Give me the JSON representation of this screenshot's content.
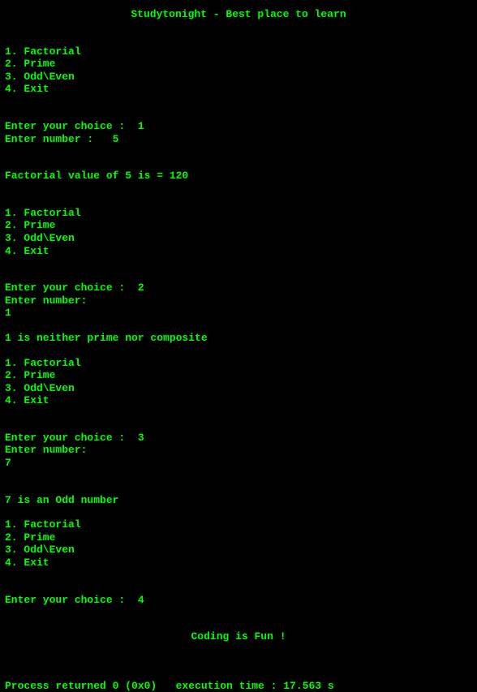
{
  "header": "Studytonight - Best place to learn",
  "menu": {
    "item1": "1. Factorial",
    "item2": "2. Prime",
    "item3": "3. Odd\\Even",
    "item4": "4. Exit"
  },
  "run1": {
    "prompt_choice": "Enter your choice :  1",
    "prompt_number": "Enter number :   5",
    "result": "Factorial value of 5 is = 120"
  },
  "run2": {
    "prompt_choice": "Enter your choice :  2",
    "prompt_number": "Enter number:",
    "input_value": "1",
    "result": "1 is neither prime nor composite"
  },
  "run3": {
    "prompt_choice": "Enter your choice :  3",
    "prompt_number": "Enter number:",
    "input_value": "7",
    "result": "7 is an Odd number"
  },
  "run4": {
    "prompt_choice": "Enter your choice :  4"
  },
  "footer": "Coding is Fun !",
  "process": "Process returned 0 (0x0)   execution time : 17.563 s"
}
